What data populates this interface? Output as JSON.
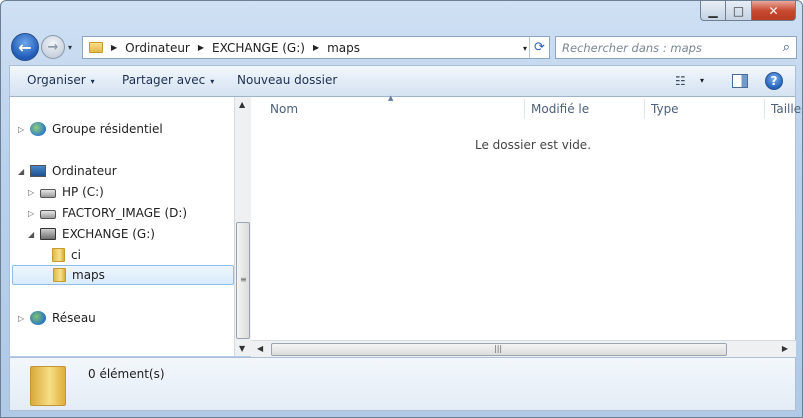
{
  "window": {
    "caption": {
      "minimize": "▁",
      "maximize": "□",
      "close": "✕"
    }
  },
  "nav": {
    "back_icon": "arrow-left",
    "forward_icon": "arrow-right",
    "history_caret": "▾",
    "breadcrumb": [
      "Ordinateur",
      "EXCHANGE (G:)",
      "maps"
    ],
    "breadcrumb_sep": "▶",
    "dropdown": "▾",
    "refresh": "⟳",
    "search_placeholder": "Rechercher dans : maps",
    "search_icon": "⌕"
  },
  "toolbar": {
    "organize": "Organiser",
    "share": "Partager avec",
    "new_folder": "Nouveau dossier",
    "caret": "▾",
    "view_icon": "☷",
    "help": "?"
  },
  "tree": {
    "items": [
      {
        "label": "Groupe résidentiel",
        "expander": "▷"
      },
      {
        "label": "Ordinateur",
        "expander": "◢"
      },
      {
        "label": "HP (C:)",
        "expander": "▷"
      },
      {
        "label": "FACTORY_IMAGE (D:)",
        "expander": "▷"
      },
      {
        "label": "EXCHANGE (G:)",
        "expander": "◢"
      },
      {
        "label": "ci",
        "expander": ""
      },
      {
        "label": "maps",
        "expander": ""
      },
      {
        "label": "Réseau",
        "expander": "▷"
      }
    ]
  },
  "columns": [
    "Nom",
    "Modifié le",
    "Type",
    "Taille"
  ],
  "sort_indicator": "▲",
  "content": {
    "empty_message": "Le dossier est vide."
  },
  "scroll": {
    "up": "▲",
    "down": "▼",
    "left": "◀",
    "right": "▶",
    "grip_v": "≡",
    "grip_h": "|||"
  },
  "details": {
    "count": "0 élément(s)"
  }
}
